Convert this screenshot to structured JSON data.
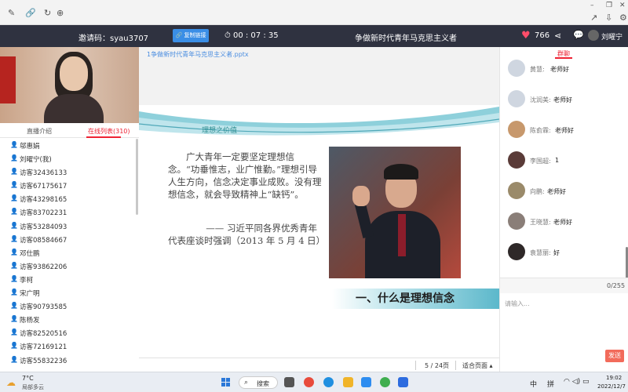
{
  "header": {
    "invite_label": "邀请码：syau3707",
    "copy_button": "复制链接",
    "timer": "00 : 07 : 35",
    "title": "争做新时代青年马克思主义者",
    "likes": "766",
    "user_name": "刘曜宁"
  },
  "left": {
    "tabs": {
      "intro": "直播介绍",
      "online": "在线列表(310)"
    },
    "users": [
      "邬惠娟",
      "刘曜宁(我)",
      "访客32436133",
      "访客67175617",
      "访客43298165",
      "访客83702231",
      "访客53284093",
      "访客08584667",
      "邓仕鹏",
      "访客93862206",
      "李柯",
      "宋广明",
      "访客90793585",
      "陈杨发",
      "访客82520516",
      "访客72169121",
      "访客55832236"
    ]
  },
  "center": {
    "file_name": "1争做新时代青年马克思主义者.pptx",
    "slide": {
      "section_title": "理想之价值",
      "quote": "广大青年一定要坚定理想信念。“功垂惟志，业广惟勤。”理想引导人生方向，信念决定事业成败。没有理想信念，就会导致精神上“缺钙”。",
      "citation": "—— 习近平同各界优秀青年代表座谈时强调（2013 年 5 月 4 日）",
      "banner": "一、什么是理想信念"
    },
    "pager": {
      "page": "5 / 24页",
      "fit": "适合页面 ▴"
    }
  },
  "chat": {
    "tab": "群聊",
    "messages": [
      {
        "name": "黄慧:",
        "text": "老师好"
      },
      {
        "name": "沈润美:",
        "text": "老师好"
      },
      {
        "name": "陈俞霖:",
        "text": "老师好"
      },
      {
        "name": "李国超:",
        "text": "1"
      },
      {
        "name": "向鹏:",
        "text": "老师好"
      },
      {
        "name": "王晓慧:",
        "text": "老师好"
      },
      {
        "name": "袁慧丽:",
        "text": "好"
      }
    ],
    "counter": "0/255",
    "input_placeholder": "请输入...",
    "send_label": "发送"
  },
  "taskbar": {
    "temp": "7°C",
    "weather": "局部多云",
    "search": "搜索",
    "lang": "中",
    "ime": "拼",
    "time": "19:02",
    "date": "2022/12/7"
  },
  "colors": {
    "header_bg": "#2f3240",
    "accent": "#e22233",
    "link": "#4a8de0",
    "send": "#f26b5b"
  }
}
